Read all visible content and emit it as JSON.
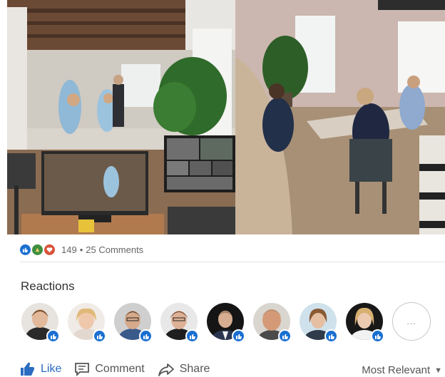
{
  "post": {
    "reactions_count": "149",
    "separator": "•",
    "comments_count": "25 Comments"
  },
  "reactions_section": {
    "title": "Reactions",
    "more_label": "..."
  },
  "actions": {
    "like_label": "Like",
    "comment_label": "Comment",
    "share_label": "Share"
  },
  "sort": {
    "label": "Most Relevant"
  },
  "reaction_icons": [
    "like-icon",
    "celebrate-icon",
    "love-icon"
  ],
  "colors": {
    "like_blue": "#1a6fd1",
    "celebrate_green": "#3e8e3e",
    "love_red": "#d9533a",
    "text_primary": "#333333",
    "text_secondary": "#666666"
  }
}
